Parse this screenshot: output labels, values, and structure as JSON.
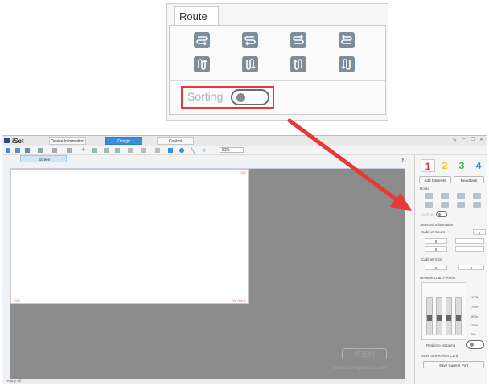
{
  "callout": {
    "tab_label": "Route",
    "sorting_label": "Sorting",
    "sorting_enabled": false,
    "route_icons": [
      "route-snake-h-1-icon",
      "route-snake-h-2-icon",
      "route-snake-h-3-icon",
      "route-snake-h-4-icon",
      "route-snake-v-1-icon",
      "route-snake-v-2-icon",
      "route-snake-v-3-icon",
      "route-snake-v-4-icon"
    ]
  },
  "app": {
    "title": "iSet",
    "tabs": [
      "Device Information",
      "Design",
      "Control"
    ],
    "active_tab_color": "#3a8fd8",
    "zoom_level": "81%",
    "canvas_tab": "Screen",
    "screen_top_right": "1920",
    "screen_bottom_left": "1080",
    "screen_bottom_right": "(W, Right)",
    "watermark_logo": "卡莱特",
    "watermark_url": "www.colorlightinside.com"
  },
  "panel": {
    "card_tabs": [
      {
        "label": "1",
        "color": "#e53935"
      },
      {
        "label": "2",
        "color": "#f0c419"
      },
      {
        "label": "3",
        "color": "#4caf50"
      },
      {
        "label": "4",
        "color": "#3a8fd8"
      }
    ],
    "add_cabinets": "Add Cabinets",
    "readback": "Readback",
    "route_label": "Route",
    "sorting_label": "Sorting",
    "selected_info": "Selected Information",
    "cabinet_count": "Cabinet Count",
    "cabinet_count_val": "0",
    "cabinet_size": "Cabinet Size",
    "network_load": "Network Load Percent",
    "percent_labels": [
      "100%",
      "75%",
      "50%",
      "25%",
      "0%"
    ],
    "realtime_mapping": "Realtime Mapping",
    "save_to_receiver": "Save to Receiver Card",
    "save_current_port": "Save Current Port"
  },
  "statusbar": {
    "text": "Ready All"
  },
  "colors": {
    "highlight_red": "#e53935",
    "arrow_red": "#e53935"
  }
}
